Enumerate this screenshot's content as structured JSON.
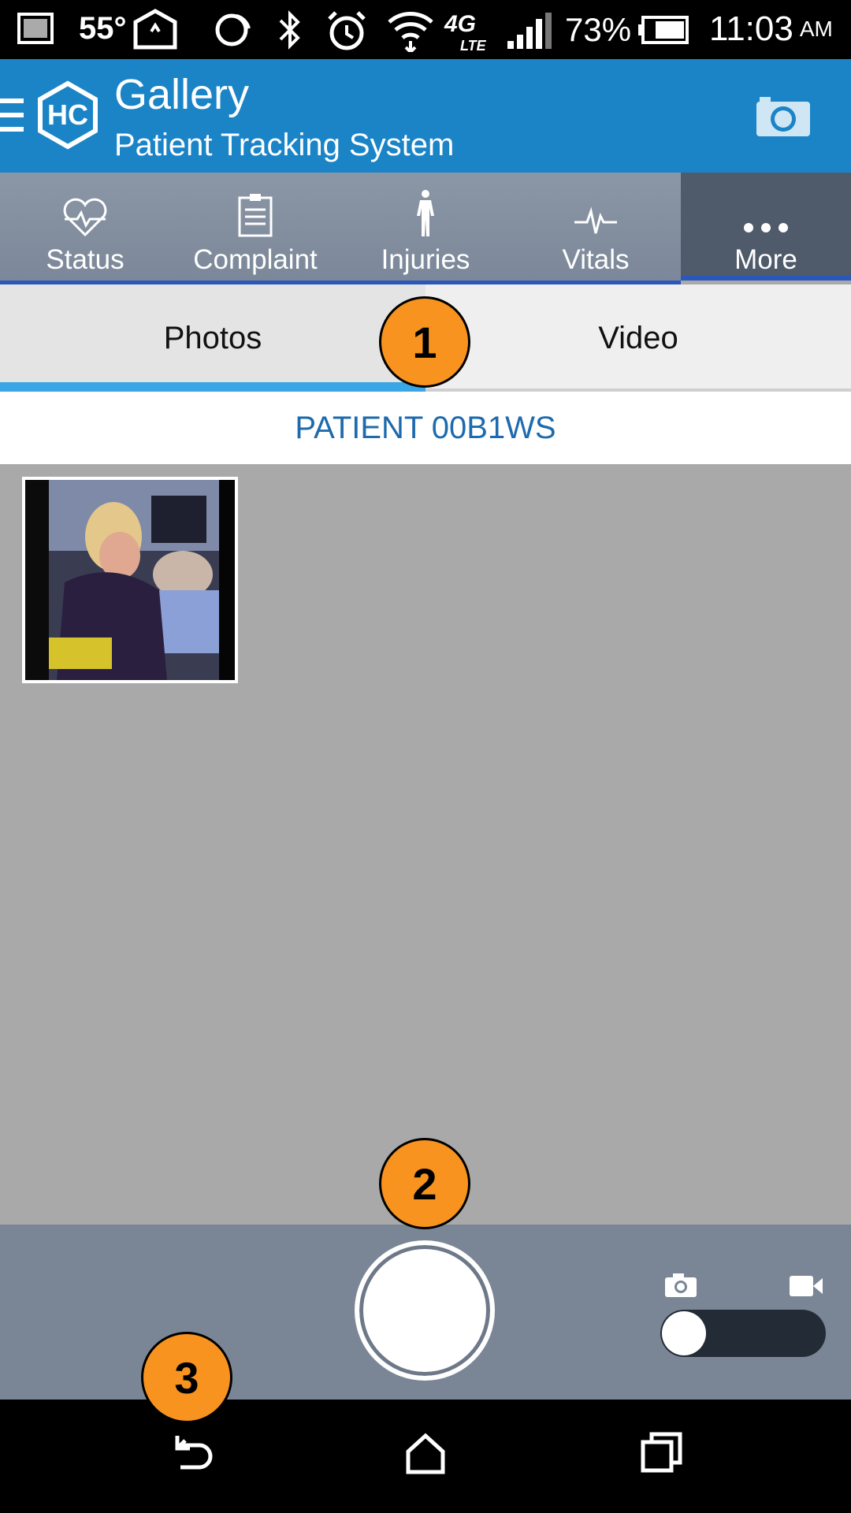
{
  "status_bar": {
    "temperature": "55°",
    "battery_percent": "73%",
    "time": "11:03",
    "ampm": "AM",
    "network": "4G LTE",
    "icons": [
      "gallery-icon",
      "wifi-calling-icon",
      "nfc-icon",
      "bluetooth-icon",
      "alarm-icon",
      "wifi-icon",
      "signal-icon",
      "battery-icon"
    ]
  },
  "app_bar": {
    "logo_text": "HC",
    "title": "Gallery",
    "subtitle": "Patient Tracking System",
    "accent_color": "#1a84c7"
  },
  "nav_tabs": [
    {
      "label": "Status",
      "icon": "heart-pulse-icon"
    },
    {
      "label": "Complaint",
      "icon": "clipboard-icon"
    },
    {
      "label": "Injuries",
      "icon": "body-figure-icon"
    },
    {
      "label": "Vitals",
      "icon": "pulse-line-icon"
    },
    {
      "label": "More",
      "icon": "more-dots-icon",
      "active": true
    }
  ],
  "media_tabs": {
    "photos": "Photos",
    "video": "Video",
    "selected": "Photos"
  },
  "patient_header": "PATIENT 00B1WS",
  "gallery": {
    "items": [
      {
        "type": "photo"
      }
    ]
  },
  "capture_bar": {
    "mode_photo_icon": "camera-icon",
    "mode_video_icon": "video-camera-icon",
    "mode_selected": "photo"
  },
  "callouts": [
    "1",
    "2",
    "3"
  ],
  "android_nav": [
    "back-icon",
    "home-icon",
    "recents-icon"
  ]
}
